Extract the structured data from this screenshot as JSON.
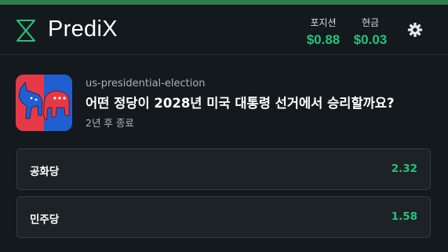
{
  "app": {
    "brand": "PrediX"
  },
  "header": {
    "position_label": "포지션",
    "position_value": "$0.88",
    "cash_label": "현금",
    "cash_value": "$0.03"
  },
  "market": {
    "slug": "us-presidential-election",
    "question": "어떤 정당이 2028년 미국 대통령 선거에서 승리할까요?",
    "ends": "2년 후 종료",
    "thumbnail_icon": "democrat-republican-donkey-elephant-icon"
  },
  "outcomes": [
    {
      "name": "공화당",
      "price": "2.32"
    },
    {
      "name": "민주당",
      "price": "1.58"
    }
  ],
  "colors": {
    "accent_green": "#27c17a",
    "top_bar": "#2f7d4a",
    "background": "#14191d",
    "republican_red": "#e63946",
    "democrat_blue": "#1f5fd1"
  }
}
